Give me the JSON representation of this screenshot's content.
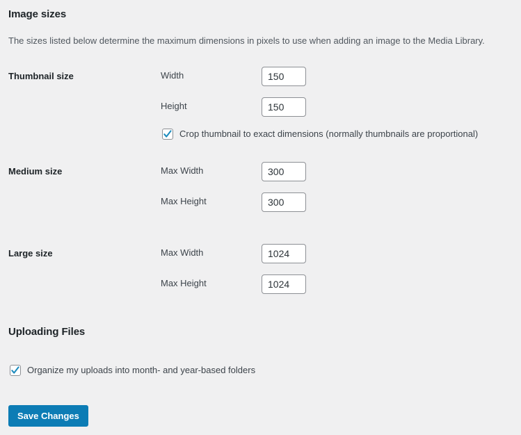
{
  "colors": {
    "background": "#f0f0f1",
    "heading_text": "#1d2327",
    "body_text": "#3c434a",
    "muted_text": "#50575e",
    "input_border": "#8c8f94",
    "accent_blue": "#0c7cb5",
    "checkmark_blue": "#1e8cbe"
  },
  "image_sizes": {
    "heading": "Image sizes",
    "description": "The sizes listed below determine the maximum dimensions in pixels to use when adding an image to the Media Library.",
    "groups": [
      {
        "label": "Thumbnail size",
        "fields": [
          {
            "label": "Width",
            "value": "150"
          },
          {
            "label": "Height",
            "value": "150"
          }
        ]
      },
      {
        "label": "Medium size",
        "fields": [
          {
            "label": "Max Width",
            "value": "300"
          },
          {
            "label": "Max Height",
            "value": "300"
          }
        ]
      },
      {
        "label": "Large size",
        "fields": [
          {
            "label": "Max Width",
            "value": "1024"
          },
          {
            "label": "Max Height",
            "value": "1024"
          }
        ]
      }
    ],
    "crop_thumbnail": {
      "label": "Crop thumbnail to exact dimensions (normally thumbnails are proportional)",
      "checked": "true"
    }
  },
  "uploading_files": {
    "heading": "Uploading Files",
    "organize_uploads": {
      "label": "Organize my uploads into month- and year-based folders",
      "checked": "true"
    }
  },
  "actions": {
    "save_label": "Save Changes"
  }
}
